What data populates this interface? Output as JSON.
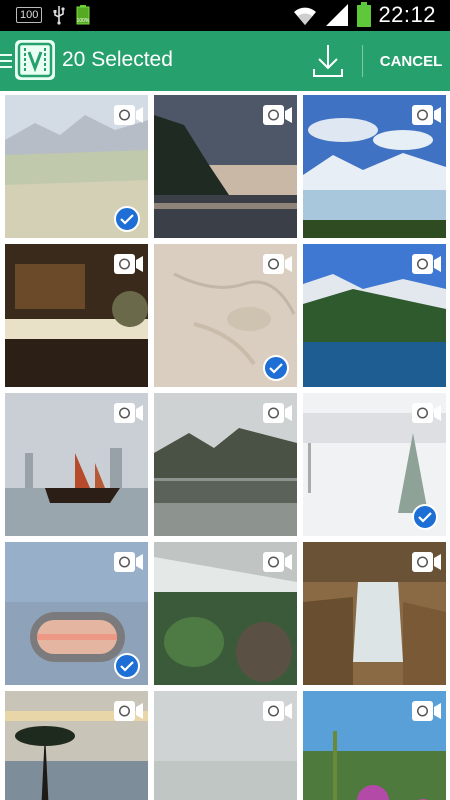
{
  "statusbar": {
    "badge": "100",
    "time": "22:12"
  },
  "appbar": {
    "title": "20 Selected",
    "cancel_label": "CANCEL"
  },
  "colors": {
    "appbar": "#26a06d",
    "check": "#1d6fd6",
    "statusbar": "#000000"
  },
  "grid": {
    "items": [
      {
        "selected": true,
        "icon": "video-camera-icon",
        "subject": "mountains-grass"
      },
      {
        "selected": false,
        "icon": "video-camera-icon",
        "subject": "cliff-beach-sunset"
      },
      {
        "selected": false,
        "icon": "video-camera-icon",
        "subject": "glacier"
      },
      {
        "selected": false,
        "icon": "video-camera-icon",
        "subject": "japanese-shop"
      },
      {
        "selected": true,
        "icon": "video-camera-icon",
        "subject": "rock-texture"
      },
      {
        "selected": false,
        "icon": "video-camera-icon",
        "subject": "mountain-lake"
      },
      {
        "selected": false,
        "icon": "video-camera-icon",
        "subject": "harbor-junk-boat"
      },
      {
        "selected": false,
        "icon": "video-camera-icon",
        "subject": "misty-lake"
      },
      {
        "selected": true,
        "icon": "video-camera-icon",
        "subject": "snow-field"
      },
      {
        "selected": true,
        "icon": "video-camera-icon",
        "subject": "car-mirror-sunset"
      },
      {
        "selected": false,
        "icon": "video-camera-icon",
        "subject": "greenhouse"
      },
      {
        "selected": false,
        "icon": "video-camera-icon",
        "subject": "waterfall"
      },
      {
        "selected": false,
        "icon": "video-camera-icon",
        "subject": "palm-beach"
      },
      {
        "selected": false,
        "icon": "video-camera-icon",
        "subject": "foggy-sky"
      },
      {
        "selected": false,
        "icon": "video-camera-icon",
        "subject": "flowers-sky"
      }
    ]
  }
}
